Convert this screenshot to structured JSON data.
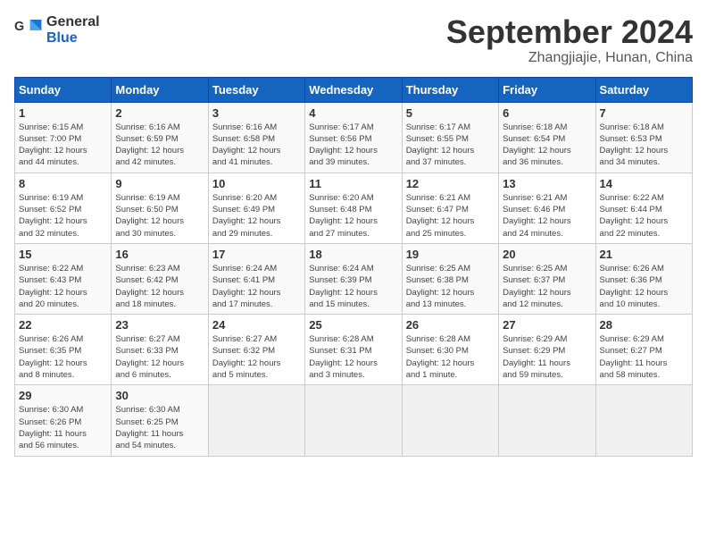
{
  "logo": {
    "line1": "General",
    "line2": "Blue"
  },
  "title": "September 2024",
  "subtitle": "Zhangjiajie, Hunan, China",
  "headers": [
    "Sunday",
    "Monday",
    "Tuesday",
    "Wednesday",
    "Thursday",
    "Friday",
    "Saturday"
  ],
  "weeks": [
    [
      {
        "day": "1",
        "info": "Sunrise: 6:15 AM\nSunset: 7:00 PM\nDaylight: 12 hours\nand 44 minutes."
      },
      {
        "day": "2",
        "info": "Sunrise: 6:16 AM\nSunset: 6:59 PM\nDaylight: 12 hours\nand 42 minutes."
      },
      {
        "day": "3",
        "info": "Sunrise: 6:16 AM\nSunset: 6:58 PM\nDaylight: 12 hours\nand 41 minutes."
      },
      {
        "day": "4",
        "info": "Sunrise: 6:17 AM\nSunset: 6:56 PM\nDaylight: 12 hours\nand 39 minutes."
      },
      {
        "day": "5",
        "info": "Sunrise: 6:17 AM\nSunset: 6:55 PM\nDaylight: 12 hours\nand 37 minutes."
      },
      {
        "day": "6",
        "info": "Sunrise: 6:18 AM\nSunset: 6:54 PM\nDaylight: 12 hours\nand 36 minutes."
      },
      {
        "day": "7",
        "info": "Sunrise: 6:18 AM\nSunset: 6:53 PM\nDaylight: 12 hours\nand 34 minutes."
      }
    ],
    [
      {
        "day": "8",
        "info": "Sunrise: 6:19 AM\nSunset: 6:52 PM\nDaylight: 12 hours\nand 32 minutes."
      },
      {
        "day": "9",
        "info": "Sunrise: 6:19 AM\nSunset: 6:50 PM\nDaylight: 12 hours\nand 30 minutes."
      },
      {
        "day": "10",
        "info": "Sunrise: 6:20 AM\nSunset: 6:49 PM\nDaylight: 12 hours\nand 29 minutes."
      },
      {
        "day": "11",
        "info": "Sunrise: 6:20 AM\nSunset: 6:48 PM\nDaylight: 12 hours\nand 27 minutes."
      },
      {
        "day": "12",
        "info": "Sunrise: 6:21 AM\nSunset: 6:47 PM\nDaylight: 12 hours\nand 25 minutes."
      },
      {
        "day": "13",
        "info": "Sunrise: 6:21 AM\nSunset: 6:46 PM\nDaylight: 12 hours\nand 24 minutes."
      },
      {
        "day": "14",
        "info": "Sunrise: 6:22 AM\nSunset: 6:44 PM\nDaylight: 12 hours\nand 22 minutes."
      }
    ],
    [
      {
        "day": "15",
        "info": "Sunrise: 6:22 AM\nSunset: 6:43 PM\nDaylight: 12 hours\nand 20 minutes."
      },
      {
        "day": "16",
        "info": "Sunrise: 6:23 AM\nSunset: 6:42 PM\nDaylight: 12 hours\nand 18 minutes."
      },
      {
        "day": "17",
        "info": "Sunrise: 6:24 AM\nSunset: 6:41 PM\nDaylight: 12 hours\nand 17 minutes."
      },
      {
        "day": "18",
        "info": "Sunrise: 6:24 AM\nSunset: 6:39 PM\nDaylight: 12 hours\nand 15 minutes."
      },
      {
        "day": "19",
        "info": "Sunrise: 6:25 AM\nSunset: 6:38 PM\nDaylight: 12 hours\nand 13 minutes."
      },
      {
        "day": "20",
        "info": "Sunrise: 6:25 AM\nSunset: 6:37 PM\nDaylight: 12 hours\nand 12 minutes."
      },
      {
        "day": "21",
        "info": "Sunrise: 6:26 AM\nSunset: 6:36 PM\nDaylight: 12 hours\nand 10 minutes."
      }
    ],
    [
      {
        "day": "22",
        "info": "Sunrise: 6:26 AM\nSunset: 6:35 PM\nDaylight: 12 hours\nand 8 minutes."
      },
      {
        "day": "23",
        "info": "Sunrise: 6:27 AM\nSunset: 6:33 PM\nDaylight: 12 hours\nand 6 minutes."
      },
      {
        "day": "24",
        "info": "Sunrise: 6:27 AM\nSunset: 6:32 PM\nDaylight: 12 hours\nand 5 minutes."
      },
      {
        "day": "25",
        "info": "Sunrise: 6:28 AM\nSunset: 6:31 PM\nDaylight: 12 hours\nand 3 minutes."
      },
      {
        "day": "26",
        "info": "Sunrise: 6:28 AM\nSunset: 6:30 PM\nDaylight: 12 hours\nand 1 minute."
      },
      {
        "day": "27",
        "info": "Sunrise: 6:29 AM\nSunset: 6:29 PM\nDaylight: 11 hours\nand 59 minutes."
      },
      {
        "day": "28",
        "info": "Sunrise: 6:29 AM\nSunset: 6:27 PM\nDaylight: 11 hours\nand 58 minutes."
      }
    ],
    [
      {
        "day": "29",
        "info": "Sunrise: 6:30 AM\nSunset: 6:26 PM\nDaylight: 11 hours\nand 56 minutes."
      },
      {
        "day": "30",
        "info": "Sunrise: 6:30 AM\nSunset: 6:25 PM\nDaylight: 11 hours\nand 54 minutes."
      },
      {
        "day": "",
        "info": ""
      },
      {
        "day": "",
        "info": ""
      },
      {
        "day": "",
        "info": ""
      },
      {
        "day": "",
        "info": ""
      },
      {
        "day": "",
        "info": ""
      }
    ]
  ]
}
